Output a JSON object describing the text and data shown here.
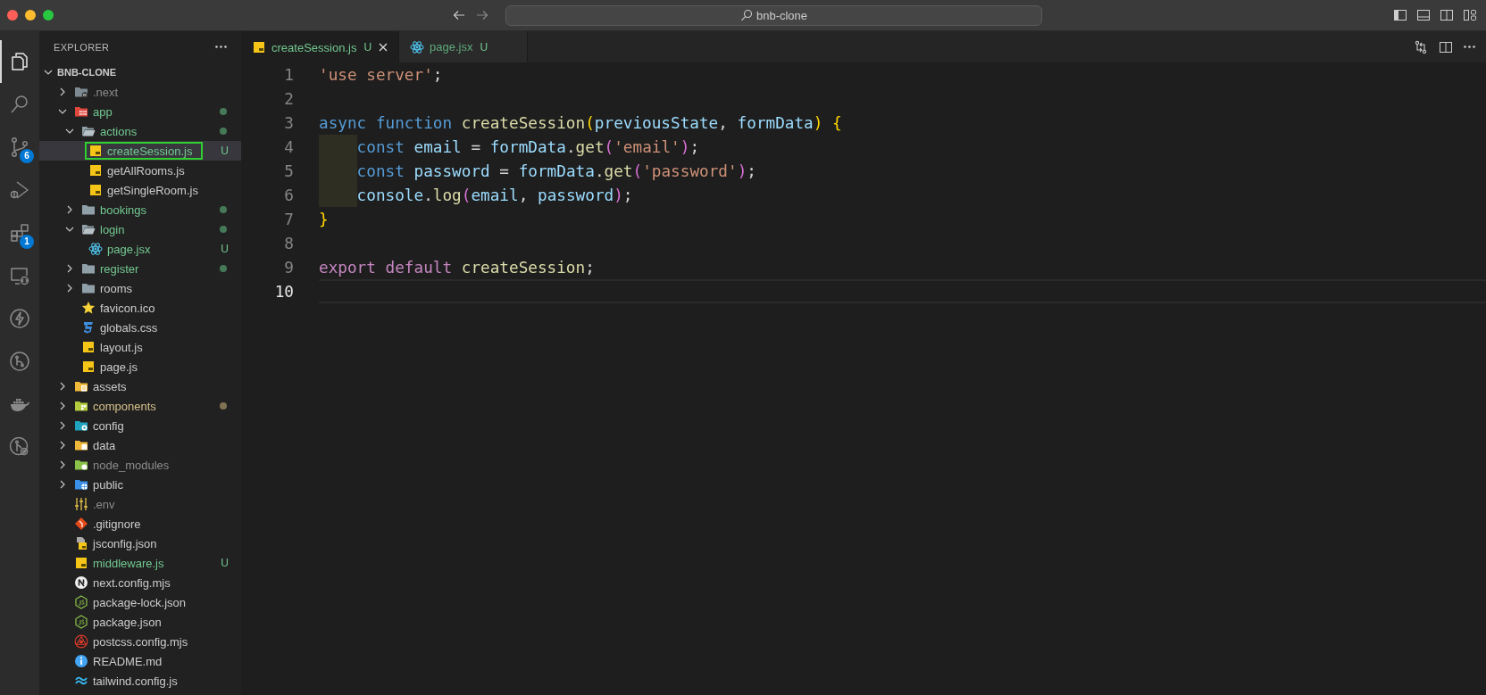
{
  "window": {
    "title": "bnb-clone"
  },
  "activity_bar": [
    {
      "kind": "files",
      "selected": true
    },
    {
      "kind": "search",
      "selected": false
    },
    {
      "kind": "source-control",
      "selected": false,
      "badge": "6"
    },
    {
      "kind": "run-debug",
      "selected": false
    },
    {
      "kind": "extensions",
      "selected": false,
      "badge": "1"
    },
    {
      "kind": "remote",
      "selected": false
    },
    {
      "kind": "lightning",
      "selected": false
    },
    {
      "kind": "git-graph",
      "selected": false
    },
    {
      "kind": "docker",
      "selected": false
    },
    {
      "kind": "git-history",
      "selected": false
    }
  ],
  "explorer": {
    "title": "EXPLORER",
    "root": {
      "label": "BNB-CLONE",
      "expanded": true
    },
    "tree": [
      {
        "name": ".next",
        "kind": "next-folder",
        "expanded": false,
        "color": "#8c8c8c",
        "dot": false,
        "selected": false
      },
      {
        "name": "app",
        "kind": "app-folder",
        "expanded": true,
        "color": "#73c991",
        "dot": true,
        "selected": false,
        "children": [
          {
            "name": "actions",
            "kind": "folder",
            "expanded": true,
            "color": "#73c991",
            "dot": true,
            "selected": false,
            "children": [
              {
                "name": "createSession.js",
                "kind": "js",
                "color": "#73c991",
                "badge": "U",
                "selected": true
              },
              {
                "name": "getAllRooms.js",
                "kind": "js",
                "color": "#cccccc",
                "selected": false
              },
              {
                "name": "getSingleRoom.js",
                "kind": "js",
                "color": "#cccccc",
                "selected": false
              }
            ]
          },
          {
            "name": "bookings",
            "kind": "folder",
            "expanded": false,
            "color": "#73c991",
            "dot": true,
            "selected": false
          },
          {
            "name": "login",
            "kind": "folder",
            "expanded": true,
            "color": "#73c991",
            "dot": true,
            "selected": false,
            "children": [
              {
                "name": "page.jsx",
                "kind": "react",
                "color": "#73c991",
                "badge": "U",
                "selected": false
              }
            ]
          },
          {
            "name": "register",
            "kind": "folder",
            "expanded": false,
            "color": "#73c991",
            "dot": true,
            "selected": false
          },
          {
            "name": "rooms",
            "kind": "folder",
            "expanded": false,
            "color": "#cccccc",
            "dot": false,
            "selected": false
          },
          {
            "name": "favicon.ico",
            "kind": "star",
            "color": "#cccccc",
            "selected": false
          },
          {
            "name": "globals.css",
            "kind": "css",
            "color": "#cccccc",
            "selected": false
          },
          {
            "name": "layout.js",
            "kind": "js",
            "color": "#cccccc",
            "selected": false
          },
          {
            "name": "page.js",
            "kind": "js",
            "color": "#cccccc",
            "selected": false
          }
        ]
      },
      {
        "name": "assets",
        "kind": "assets-folder",
        "expanded": false,
        "color": "#cccccc",
        "dot": false,
        "selected": false
      },
      {
        "name": "components",
        "kind": "components-folder",
        "expanded": false,
        "color": "#d6c08a",
        "dot": true,
        "selected": false
      },
      {
        "name": "config",
        "kind": "config-folder",
        "expanded": false,
        "color": "#cccccc",
        "dot": false,
        "selected": false
      },
      {
        "name": "data",
        "kind": "data-folder",
        "expanded": false,
        "color": "#cccccc",
        "dot": false,
        "selected": false
      },
      {
        "name": "node_modules",
        "kind": "node-folder",
        "expanded": false,
        "color": "#8c8c8c",
        "dot": false,
        "selected": false
      },
      {
        "name": "public",
        "kind": "public-folder",
        "expanded": false,
        "color": "#cccccc",
        "dot": false,
        "selected": false
      },
      {
        "name": ".env",
        "kind": "env",
        "color": "#8c8c8c",
        "selected": false
      },
      {
        "name": ".gitignore",
        "kind": "git",
        "color": "#cccccc",
        "selected": false
      },
      {
        "name": "jsconfig.json",
        "kind": "jsconfig",
        "color": "#cccccc",
        "selected": false
      },
      {
        "name": "middleware.js",
        "kind": "js",
        "color": "#73c991",
        "badge": "U",
        "selected": false
      },
      {
        "name": "next.config.mjs",
        "kind": "next",
        "color": "#cccccc",
        "selected": false
      },
      {
        "name": "package-lock.json",
        "kind": "npm",
        "color": "#cccccc",
        "selected": false
      },
      {
        "name": "package.json",
        "kind": "npm",
        "color": "#cccccc",
        "selected": false
      },
      {
        "name": "postcss.config.mjs",
        "kind": "postcss",
        "color": "#cccccc",
        "selected": false
      },
      {
        "name": "README.md",
        "kind": "info",
        "color": "#cccccc",
        "selected": false
      },
      {
        "name": "tailwind.config.js",
        "kind": "tailwind",
        "color": "#cccccc",
        "selected": false
      }
    ]
  },
  "tabs": [
    {
      "label": "createSession.js",
      "kind": "js",
      "badge": "U",
      "selected": true
    },
    {
      "label": "page.jsx",
      "kind": "react",
      "badge": "U",
      "selected": false
    }
  ],
  "editor": {
    "lines": [
      {
        "number": "1",
        "current": false,
        "indented": false,
        "tokens": [
          {
            "text": "'use server'",
            "kind": "string"
          },
          {
            "text": ";",
            "kind": "plain"
          }
        ]
      },
      {
        "number": "2",
        "current": false,
        "indented": false
      },
      {
        "number": "3",
        "current": false,
        "indented": false,
        "tokens": [
          {
            "text": "async function ",
            "kind": "keyword"
          },
          {
            "text": "createSession",
            "kind": "function"
          },
          {
            "text": "(",
            "kind": "bracket1"
          },
          {
            "text": "previousState",
            "kind": "variable"
          },
          {
            "text": ", ",
            "kind": "plain"
          },
          {
            "text": "formData",
            "kind": "variable"
          },
          {
            "text": ") {",
            "kind": "bracket1"
          }
        ]
      },
      {
        "number": "4",
        "current": false,
        "indented": true,
        "tokens": [
          {
            "text": "const ",
            "kind": "keyword"
          },
          {
            "text": "email",
            "kind": "variable"
          },
          {
            "text": " = ",
            "kind": "plain"
          },
          {
            "text": "formData",
            "kind": "variable"
          },
          {
            "text": ".",
            "kind": "plain"
          },
          {
            "text": "get",
            "kind": "function"
          },
          {
            "text": "(",
            "kind": "bracket2"
          },
          {
            "text": "'email'",
            "kind": "string"
          },
          {
            "text": ")",
            "kind": "bracket2"
          },
          {
            "text": ";",
            "kind": "plain"
          }
        ]
      },
      {
        "number": "5",
        "current": false,
        "indented": true,
        "tokens": [
          {
            "text": "const ",
            "kind": "keyword"
          },
          {
            "text": "password",
            "kind": "variable"
          },
          {
            "text": " = ",
            "kind": "plain"
          },
          {
            "text": "formData",
            "kind": "variable"
          },
          {
            "text": ".",
            "kind": "plain"
          },
          {
            "text": "get",
            "kind": "function"
          },
          {
            "text": "(",
            "kind": "bracket2"
          },
          {
            "text": "'password'",
            "kind": "string"
          },
          {
            "text": ")",
            "kind": "bracket2"
          },
          {
            "text": ";",
            "kind": "plain"
          }
        ]
      },
      {
        "number": "6",
        "current": false,
        "indented": true,
        "tokens": [
          {
            "text": "console",
            "kind": "variable"
          },
          {
            "text": ".",
            "kind": "plain"
          },
          {
            "text": "log",
            "kind": "function"
          },
          {
            "text": "(",
            "kind": "bracket2"
          },
          {
            "text": "email",
            "kind": "variable"
          },
          {
            "text": ", ",
            "kind": "plain"
          },
          {
            "text": "password",
            "kind": "variable"
          },
          {
            "text": ")",
            "kind": "bracket2"
          },
          {
            "text": ";",
            "kind": "plain"
          }
        ]
      },
      {
        "number": "7",
        "current": false,
        "indented": false,
        "tokens": [
          {
            "text": "}",
            "kind": "bracket1"
          }
        ]
      },
      {
        "number": "8",
        "current": false,
        "indented": false
      },
      {
        "number": "9",
        "current": false,
        "indented": false,
        "tokens": [
          {
            "text": "export default ",
            "kind": "control"
          },
          {
            "text": "createSession",
            "kind": "function"
          },
          {
            "text": ";",
            "kind": "plain"
          }
        ]
      },
      {
        "number": "10",
        "current": true,
        "indented": false
      }
    ]
  }
}
